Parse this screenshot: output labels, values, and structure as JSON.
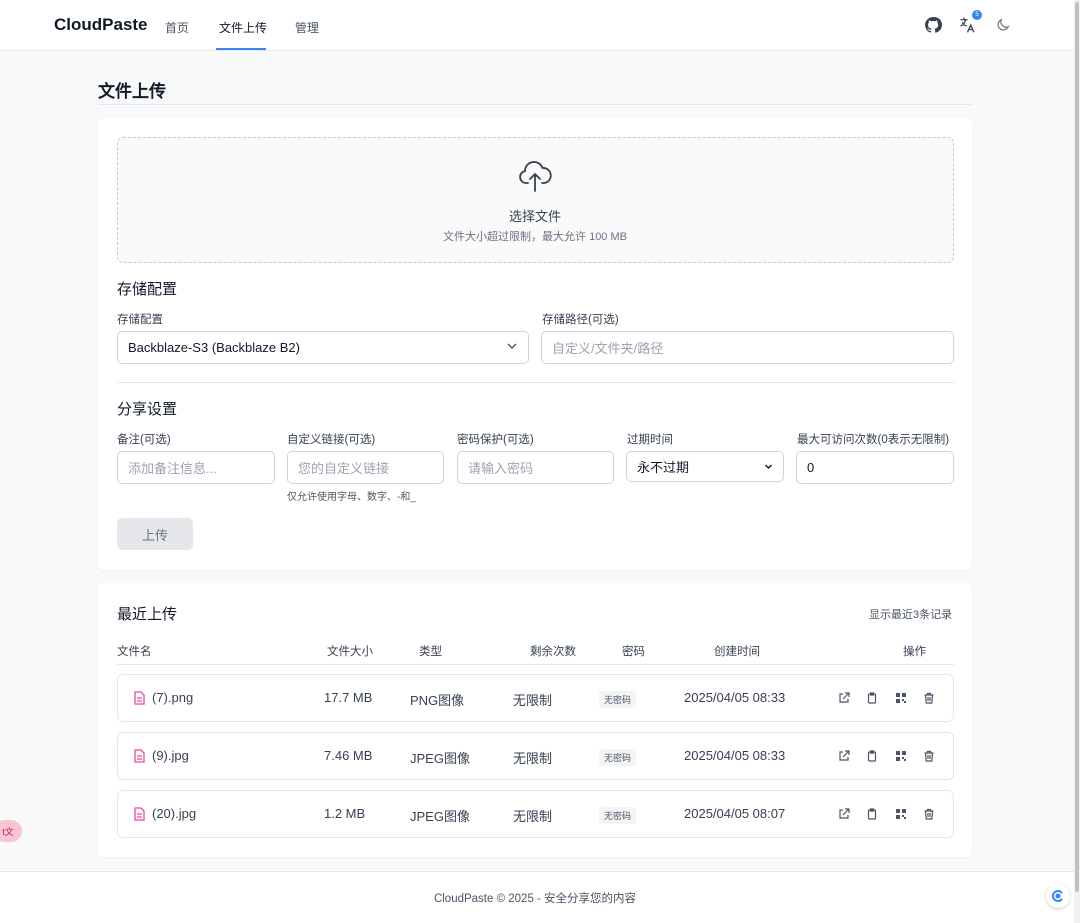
{
  "header": {
    "brand": "CloudPaste",
    "nav": [
      "首页",
      "文件上传",
      "管理"
    ],
    "lang_badge": "5"
  },
  "page": {
    "title": "文件上传"
  },
  "dropzone": {
    "title": "选择文件",
    "subtitle": "文件大小超过限制，最大允许 100 MB"
  },
  "storage": {
    "section_title": "存储配置",
    "config_label": "存储配置",
    "config_value": "Backblaze-S3 (Backblaze B2)",
    "path_label": "存储路径(可选)",
    "path_placeholder": "自定义/文件夹/路径"
  },
  "share": {
    "section_title": "分享设置",
    "note_label": "备注(可选)",
    "note_placeholder": "添加备注信息...",
    "link_label": "自定义链接(可选)",
    "link_placeholder": "您的自定义链接",
    "link_hint": "仅允许使用字母、数字、-和_",
    "password_label": "密码保护(可选)",
    "password_placeholder": "请输入密码",
    "expire_label": "过期时间",
    "expire_value": "永不过期",
    "max_label": "最大可访问次数(0表示无限制)",
    "max_value": "0"
  },
  "upload_button": "上传",
  "recent": {
    "title": "最近上传",
    "count_note": "显示最近3条记录",
    "columns": [
      "文件名",
      "文件大小",
      "类型",
      "剩余次数",
      "密码",
      "创建时间",
      "操作"
    ],
    "rows": [
      {
        "name": "(7).png",
        "size": "17.7 MB",
        "type": "PNG图像",
        "remaining": "无限制",
        "password": "无密码",
        "created": "2025/04/05 08:33"
      },
      {
        "name": "(9).jpg",
        "size": "7.46 MB",
        "type": "JPEG图像",
        "remaining": "无限制",
        "password": "无密码",
        "created": "2025/04/05 08:33"
      },
      {
        "name": "(20).jpg",
        "size": "1.2 MB",
        "type": "JPEG图像",
        "remaining": "无限制",
        "password": "无密码",
        "created": "2025/04/05 08:07"
      }
    ]
  },
  "footer": {
    "text": "CloudPaste © 2025 - 安全分享您的内容"
  },
  "floating": {
    "left_label": "t文"
  },
  "colors": {
    "accent": "#3b82f6",
    "file_icon": "#ec4899"
  }
}
